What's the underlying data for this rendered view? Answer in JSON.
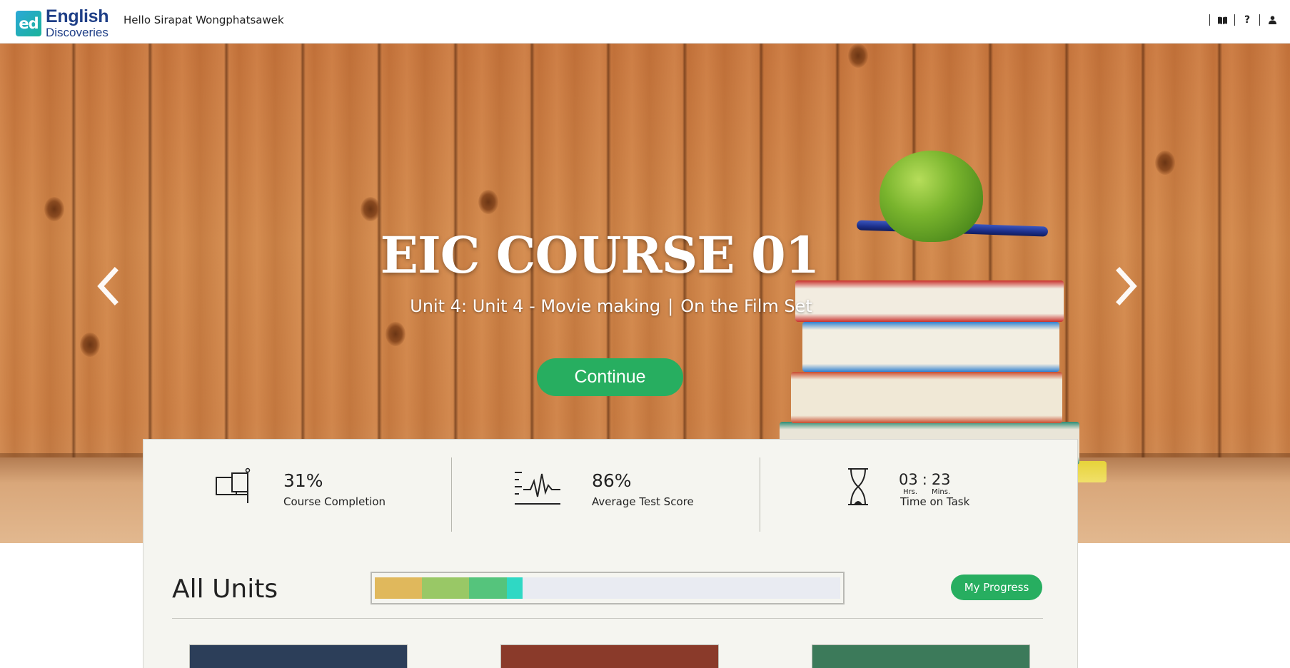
{
  "header": {
    "logo": {
      "mark": "ed",
      "line1": "English",
      "line2": "Discoveries"
    },
    "greeting": "Hello Sirapat Wongphatsawek",
    "tools": [
      {
        "name": "book-icon",
        "glyph": "📖"
      },
      {
        "name": "help-icon",
        "glyph": "?"
      },
      {
        "name": "user-icon",
        "glyph": "👤"
      }
    ]
  },
  "hero": {
    "title": "EIC COURSE 01",
    "unit": "Unit 4: Unit 4 - Movie making",
    "lesson": "On the Film Set",
    "separator": "|",
    "continue_label": "Continue",
    "prev_icon": "chevron-left-icon",
    "next_icon": "chevron-right-icon"
  },
  "stats": {
    "completion": {
      "value": "31%",
      "label": "Course Completion",
      "icon": "flag-icon"
    },
    "score": {
      "value": "86%",
      "label": "Average Test Score",
      "icon": "pulse-icon"
    },
    "time": {
      "hours": "03",
      "colon": ":",
      "minutes": "23",
      "hours_label": "Hrs.",
      "minutes_label": "Mins.",
      "label": "Time on Task",
      "icon": "hourglass-icon"
    }
  },
  "units": {
    "title": "All Units",
    "my_progress_label": "My Progress",
    "progress_segments": [
      {
        "color": "#e0b85c",
        "fraction": 0.101
      },
      {
        "color": "#99c866",
        "fraction": 0.101
      },
      {
        "color": "#55c47c",
        "fraction": 0.082
      },
      {
        "color": "#2fd8c4",
        "fraction": 0.033
      }
    ],
    "track_color": "#e9ebf2",
    "thumbnails": [
      {
        "name": "unit-thumbnail-1",
        "color": "#2c3e59"
      },
      {
        "name": "unit-thumbnail-2",
        "color": "#8a3a2a"
      },
      {
        "name": "unit-thumbnail-3",
        "color": "#3c7a5a"
      }
    ]
  },
  "colors": {
    "accent": "#27ae60",
    "brand": "#1f3f87"
  }
}
